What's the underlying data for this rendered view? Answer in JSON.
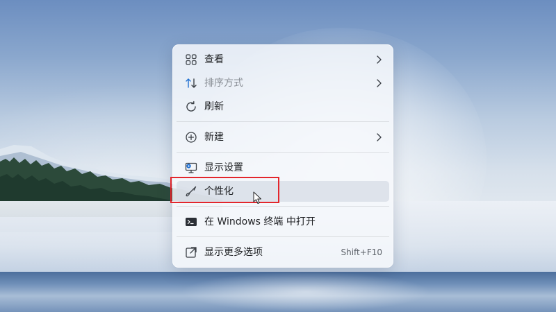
{
  "menu": {
    "items": [
      {
        "label": "查看",
        "icon": "grid-view-icon",
        "has_submenu": true
      },
      {
        "label": "排序方式",
        "icon": "sort-icon",
        "has_submenu": true
      },
      {
        "label": "刷新",
        "icon": "refresh-icon",
        "has_submenu": false
      },
      {
        "label": "新建",
        "icon": "new-plus-icon",
        "has_submenu": true
      },
      {
        "label": "显示设置",
        "icon": "display-settings-icon",
        "has_submenu": false
      },
      {
        "label": "个性化",
        "icon": "brush-icon",
        "has_submenu": false,
        "hovered": true
      },
      {
        "label": "在 Windows 终端 中打开",
        "icon": "terminal-icon",
        "has_submenu": false
      },
      {
        "label": "显示更多选项",
        "icon": "more-options-icon",
        "has_submenu": false,
        "shortcut": "Shift+F10"
      }
    ]
  },
  "annotation": {
    "highlight_color": "#e3262c",
    "highlighted_item": "个性化"
  },
  "colors": {
    "accent_blue": "#1f6fd1",
    "text": "#1f2124",
    "dim_text": "#8a8f96"
  }
}
